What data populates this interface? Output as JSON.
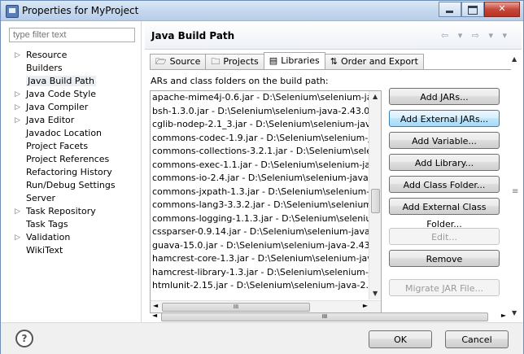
{
  "window": {
    "title": "Properties for MyProject"
  },
  "filter": {
    "placeholder": "type filter text"
  },
  "tree": [
    {
      "label": "Resource",
      "expand": true
    },
    {
      "label": "Builders",
      "expand": false
    },
    {
      "label": "Java Build Path",
      "expand": false,
      "selected": true
    },
    {
      "label": "Java Code Style",
      "expand": true
    },
    {
      "label": "Java Compiler",
      "expand": true
    },
    {
      "label": "Java Editor",
      "expand": true
    },
    {
      "label": "Javadoc Location",
      "expand": false
    },
    {
      "label": "Project Facets",
      "expand": false
    },
    {
      "label": "Project References",
      "expand": false
    },
    {
      "label": "Refactoring History",
      "expand": false
    },
    {
      "label": "Run/Debug Settings",
      "expand": false
    },
    {
      "label": "Server",
      "expand": false
    },
    {
      "label": "Task Repository",
      "expand": true
    },
    {
      "label": "Task Tags",
      "expand": false
    },
    {
      "label": "Validation",
      "expand": true
    },
    {
      "label": "WikiText",
      "expand": false
    }
  ],
  "header": {
    "title": "Java Build Path",
    "nav": "⇦ ▾ ⇨ ▾ ▾"
  },
  "tabs": [
    {
      "label": "Source",
      "icon": "source-icon"
    },
    {
      "label": "Projects",
      "icon": "projects-icon"
    },
    {
      "label": "Libraries",
      "icon": "libraries-icon",
      "active": true
    },
    {
      "label": "Order and Export",
      "icon": "order-export-icon"
    }
  ],
  "libraries": {
    "label": "ARs and class folders on the build path:",
    "items": [
      "apache-mime4j-0.6.jar - D:\\Selenium\\selenium-java-2.43",
      "bsh-1.3.0.jar - D:\\Selenium\\selenium-java-2.43.0\\seleniu",
      "cglib-nodep-2.1_3.jar - D:\\Selenium\\selenium-java-2.43.0",
      "commons-codec-1.9.jar - D:\\Selenium\\selenium-java-2.4",
      "commons-collections-3.2.1.jar - D:\\Selenium\\selenium-j",
      "commons-exec-1.1.jar - D:\\Selenium\\selenium-java-2.43",
      "commons-io-2.4.jar - D:\\Selenium\\selenium-java-2.43.0\\",
      "commons-jxpath-1.3.jar - D:\\Selenium\\selenium-java-2.4",
      "commons-lang3-3.3.2.jar - D:\\Selenium\\selenium-java-2",
      "commons-logging-1.1.3.jar - D:\\Selenium\\selenium-java",
      "cssparser-0.9.14.jar - D:\\Selenium\\selenium-java-2.43.0\\s",
      "guava-15.0.jar - D:\\Selenium\\selenium-java-2.43.0\\seleni",
      "hamcrest-core-1.3.jar - D:\\Selenium\\selenium-java-2.43.",
      "hamcrest-library-1.3.jar - D:\\Selenium\\selenium-java-2.4",
      "htmlunit-2.15.jar - D:\\Selenium\\selenium-java-2.43.0\\sel"
    ]
  },
  "buttons": {
    "add_jars": "Add JARs...",
    "add_external_jars": "Add External JARs...",
    "add_variable": "Add Variable...",
    "add_library": "Add Library...",
    "add_class_folder": "Add Class Folder...",
    "add_external_class_folder": "Add External Class Folder...",
    "edit": "Edit...",
    "remove": "Remove",
    "migrate_jar": "Migrate JAR File..."
  },
  "footer": {
    "help": "?",
    "ok": "OK",
    "cancel": "Cancel"
  },
  "scroll": {
    "grip": "III"
  }
}
